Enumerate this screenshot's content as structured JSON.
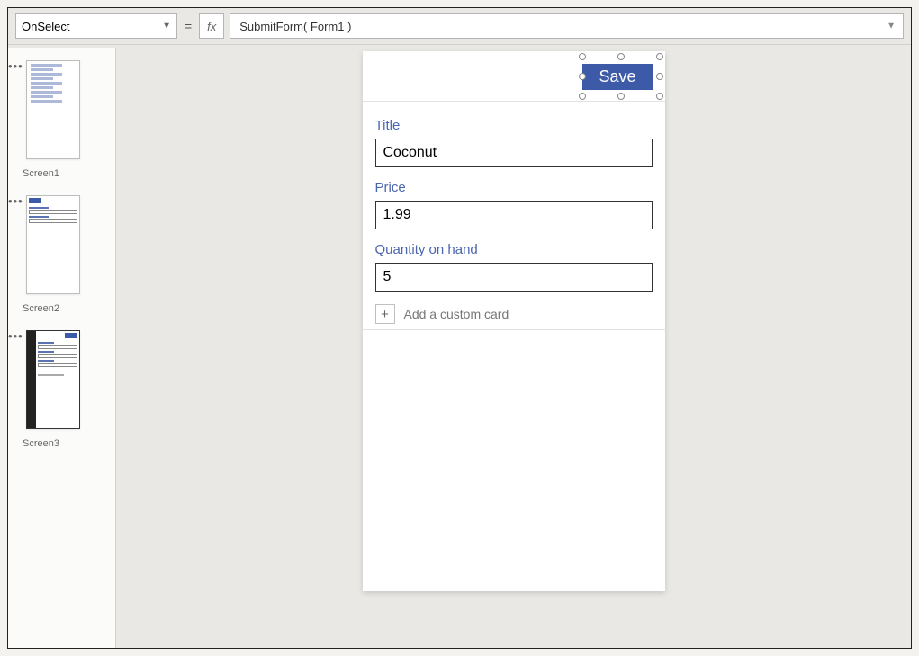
{
  "formula_bar": {
    "property": "OnSelect",
    "equals": "=",
    "fx": "fx",
    "expression": "SubmitForm( Form1 )"
  },
  "screens": {
    "s1": "Screen1",
    "s2": "Screen2",
    "s3": "Screen3"
  },
  "phone": {
    "save_label": "Save",
    "fields": {
      "title": {
        "label": "Title",
        "value": "Coconut"
      },
      "price": {
        "label": "Price",
        "value": "1.99"
      },
      "qty": {
        "label": "Quantity on hand",
        "value": "5"
      }
    },
    "add_card": "Add a custom card"
  }
}
